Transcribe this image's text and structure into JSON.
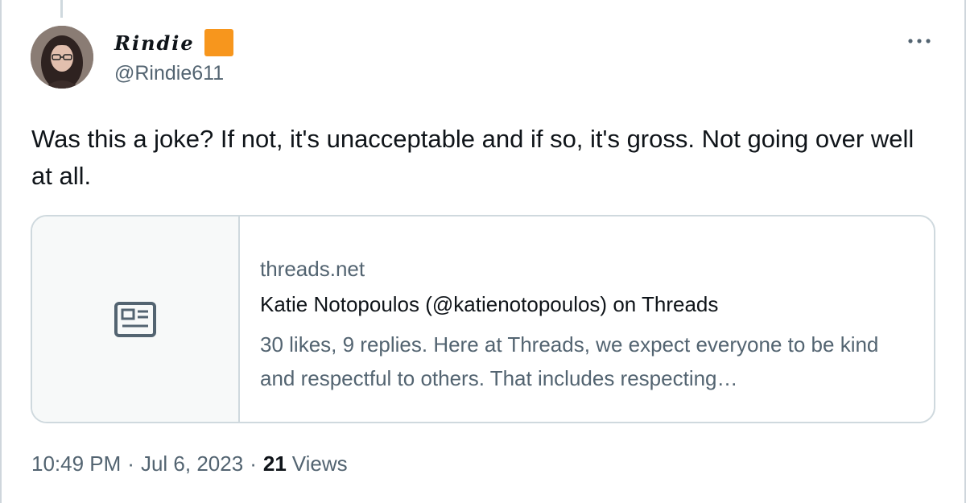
{
  "tweet": {
    "author": {
      "display_name": "Rindie",
      "handle": "@Rindie611",
      "badge_color": "#f7961d"
    },
    "more_icon": "more-horizontal-icon",
    "text": "Was this a joke? If not, it's unacceptable and if so, it's gross. Not going over well at all.",
    "link_card": {
      "icon": "newspaper-icon",
      "domain": "threads.net",
      "title": "Katie Notopoulos (@katienotopoulos) on Threads",
      "description": "30 likes, 9 replies. Here at Threads, we expect everyone to be kind and respectful to others. That includes respecting…"
    },
    "meta": {
      "time": "10:49 PM",
      "separator": "·",
      "date": "Jul 6, 2023",
      "views_count": "21",
      "views_label": "Views"
    }
  },
  "colors": {
    "text_primary": "#0f1419",
    "text_secondary": "#536471",
    "border": "#cfd9de"
  }
}
